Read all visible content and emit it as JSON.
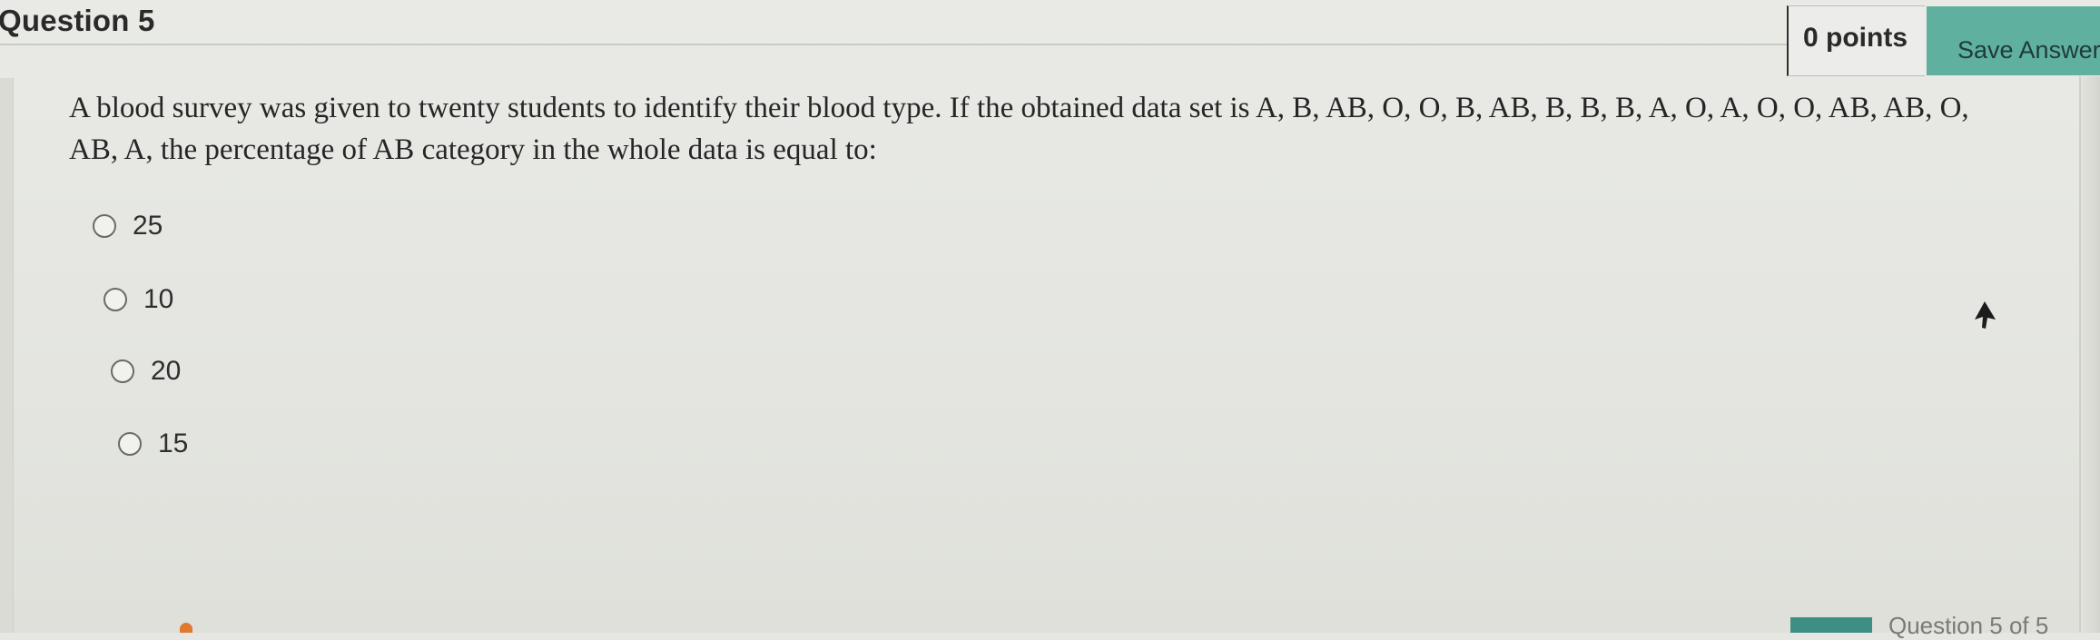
{
  "header": {
    "question_title": "Question 5",
    "points_label": "0 points",
    "save_button_label": "Save Answer"
  },
  "question": {
    "text": "A blood survey was given to twenty students to identify their blood type. If the obtained data set is A, B, AB, O, O, B, AB, B, B, B, A, O, A, O, O, AB, AB, O, AB, A, the percentage of AB category in the whole data is equal to:"
  },
  "options": [
    {
      "label": "25",
      "selected": false
    },
    {
      "label": "10",
      "selected": false
    },
    {
      "label": "20",
      "selected": false
    },
    {
      "label": "15",
      "selected": false
    }
  ],
  "footer": {
    "question_counter": "Question 5 of 5"
  },
  "colors": {
    "save_button": "#5fb09e",
    "page_background": "#e6e7e2",
    "progress": "#3d8f84"
  },
  "icons": {
    "cursor": "mouse-pointer-icon"
  }
}
